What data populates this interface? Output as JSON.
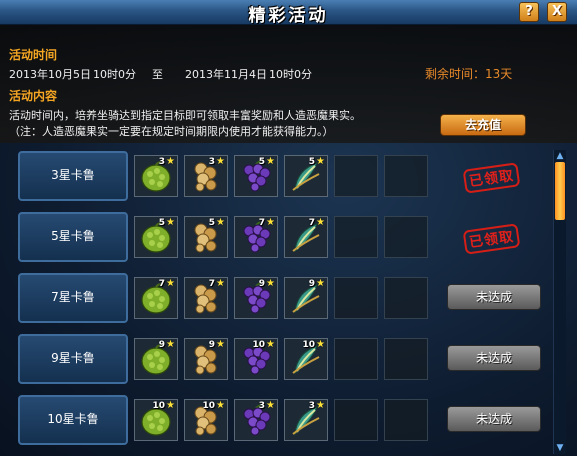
{
  "window": {
    "title": "精彩活动",
    "help_label": "?",
    "close_label": "X"
  },
  "info": {
    "time_header": "活动时间",
    "start_date": "2013年10月5日",
    "start_time": "10时0分",
    "to_label": "至",
    "end_date": "2013年11月4日",
    "end_time": "10时0分",
    "remaining": "剩余时间：13天",
    "content_header": "活动内容",
    "description": "活动时间内，培养坐骑达到指定目标即可领取丰富奖励和人造恶魔果实。",
    "note": "（注：人造恶魔果实一定要在规定时间期限内使用才能获得能力。）",
    "recharge_label": "去充值"
  },
  "colors": {
    "accent": "#f5a623",
    "claimed_red": "#e0201a"
  },
  "rewards": [
    {
      "name": "3星卡鲁",
      "items": [
        {
          "icon": "green-fruit-icon",
          "count": "3"
        },
        {
          "icon": "golden-root-icon",
          "count": "3"
        },
        {
          "icon": "grape-fruit-icon",
          "count": "5"
        },
        {
          "icon": "feather-fruit-icon",
          "count": "5"
        }
      ],
      "status": "已领取",
      "claimed": true
    },
    {
      "name": "5星卡鲁",
      "items": [
        {
          "icon": "green-fruit-icon",
          "count": "5"
        },
        {
          "icon": "golden-root-icon",
          "count": "5"
        },
        {
          "icon": "grape-fruit-icon",
          "count": "7"
        },
        {
          "icon": "feather-fruit-icon",
          "count": "7"
        }
      ],
      "status": "已领取",
      "claimed": true
    },
    {
      "name": "7星卡鲁",
      "items": [
        {
          "icon": "green-fruit-icon",
          "count": "7"
        },
        {
          "icon": "golden-root-icon",
          "count": "7"
        },
        {
          "icon": "grape-fruit-icon",
          "count": "9"
        },
        {
          "icon": "feather-fruit-icon",
          "count": "9"
        }
      ],
      "status": "未达成",
      "claimed": false
    },
    {
      "name": "9星卡鲁",
      "items": [
        {
          "icon": "green-fruit-icon",
          "count": "9"
        },
        {
          "icon": "golden-root-icon",
          "count": "9"
        },
        {
          "icon": "grape-fruit-icon",
          "count": "10"
        },
        {
          "icon": "feather-fruit-icon",
          "count": "10"
        }
      ],
      "status": "未达成",
      "claimed": false
    },
    {
      "name": "10星卡鲁",
      "items": [
        {
          "icon": "green-fruit-icon",
          "count": "10"
        },
        {
          "icon": "golden-root-icon",
          "count": "10"
        },
        {
          "icon": "grape-fruit-icon",
          "count": "3"
        },
        {
          "icon": "feather-fruit-icon",
          "count": "3"
        }
      ],
      "status": "未达成",
      "claimed": false
    }
  ]
}
